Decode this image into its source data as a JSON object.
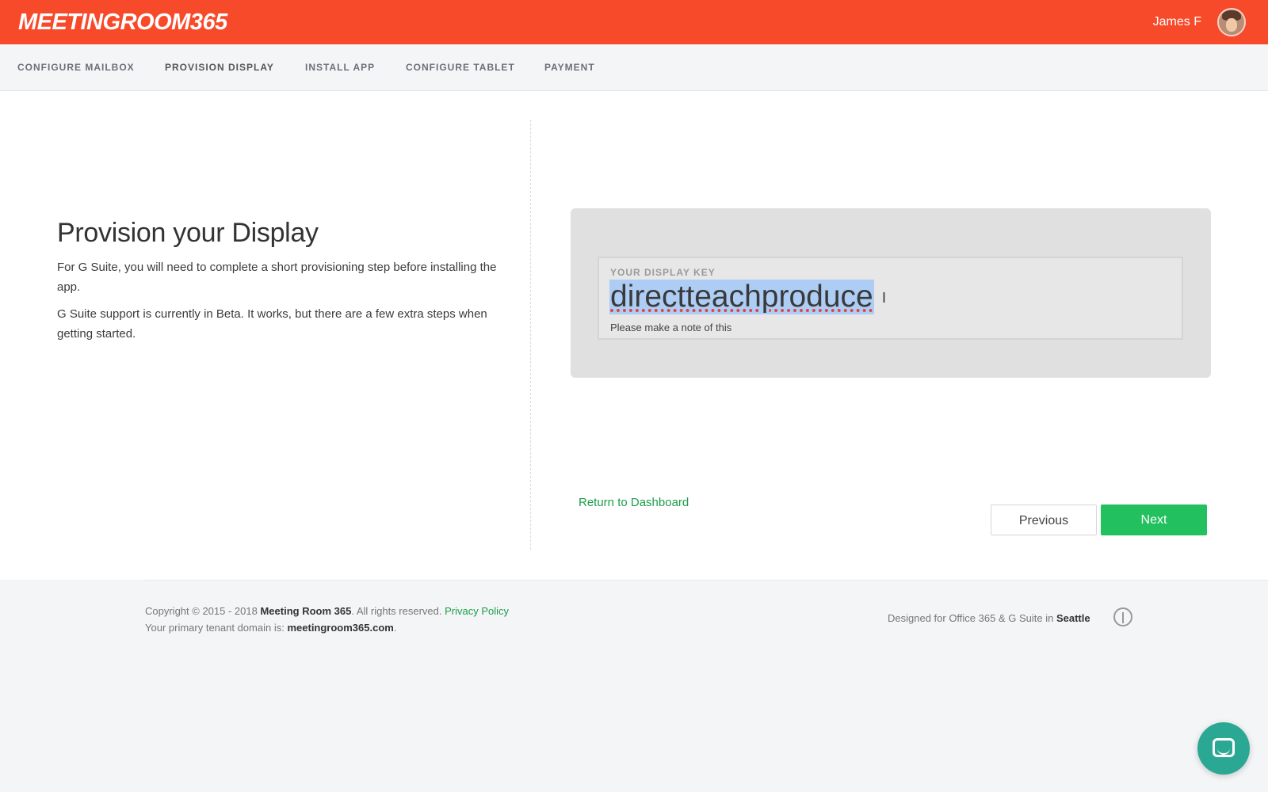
{
  "header": {
    "logo": "MEETINGROOM365",
    "user_name": "James F"
  },
  "steps": [
    {
      "label": "CONFIGURE MAILBOX"
    },
    {
      "label": "PROVISION DISPLAY",
      "active": true
    },
    {
      "label": "INSTALL APP"
    },
    {
      "label": "CONFIGURE TABLET"
    },
    {
      "label": "PAYMENT"
    }
  ],
  "content": {
    "title": "Provision your Display",
    "paragraph_1": "For G Suite, you will need to complete a short provisioning step before installing the app.",
    "paragraph_2": "G Suite support is currently in Beta. It works, but there are a few extra steps when getting started."
  },
  "display_key": {
    "label": "YOUR DISPLAY KEY",
    "value": "directteachproduce",
    "note": "Please make a note of this"
  },
  "actions": {
    "return_link": "Return to Dashboard",
    "previous_label": "Previous",
    "next_label": "Next"
  },
  "footer": {
    "copyright_prefix": "Copyright © 2015 - 2018",
    "company": "Meeting Room 365",
    "rights": ". All rights reserved.",
    "privacy_link": "Privacy Policy",
    "tenant_prefix": "Your primary tenant domain is:",
    "tenant_domain": "meetingroom365.com",
    "tenant_suffix": ".",
    "designed_prefix": "Designed for Office 365 & G Suite in",
    "designed_city": "Seattle"
  },
  "colors": {
    "brand": "#f74a2a",
    "accent_green": "#22c05e",
    "link_green": "#1b9e4b",
    "selection": "#aecdf5",
    "chat": "#2aa893"
  },
  "icons": {
    "landmark": "space-needle-icon",
    "chat": "chat-bubble-icon"
  }
}
